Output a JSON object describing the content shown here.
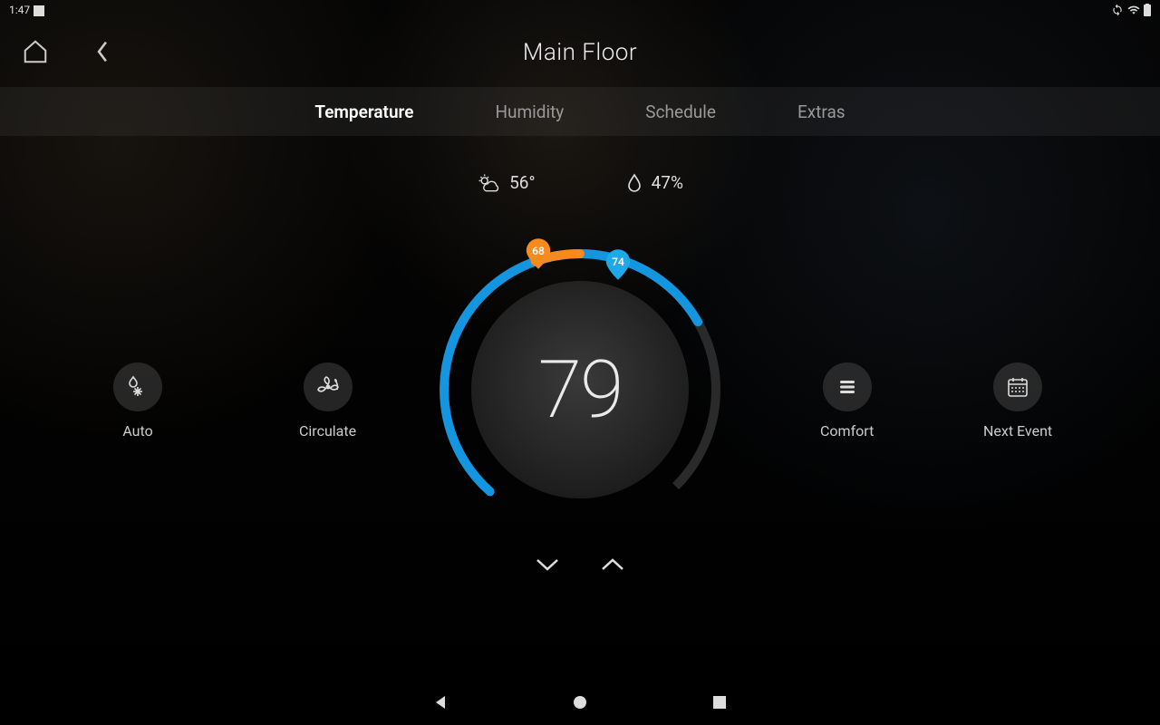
{
  "statusbar": {
    "time": "1:47"
  },
  "header": {
    "title": "Main Floor"
  },
  "tabs": [
    {
      "label": "Temperature",
      "active": true
    },
    {
      "label": "Humidity",
      "active": false
    },
    {
      "label": "Schedule",
      "active": false
    },
    {
      "label": "Extras",
      "active": false
    }
  ],
  "weather": {
    "outdoor_temp": "56°",
    "humidity": "47%"
  },
  "thermostat": {
    "current_temp": "79",
    "heat_setpoint": "68",
    "cool_setpoint": "74"
  },
  "buttons": {
    "mode": {
      "label": "Auto"
    },
    "fan": {
      "label": "Circulate"
    },
    "comfort": {
      "label": "Comfort"
    },
    "next_event": {
      "label": "Next Event"
    }
  },
  "colors": {
    "heat": "#f58a1f",
    "cool": "#1ea8e8",
    "ring": "#1395df",
    "ring_track": "#2e2e2e"
  }
}
